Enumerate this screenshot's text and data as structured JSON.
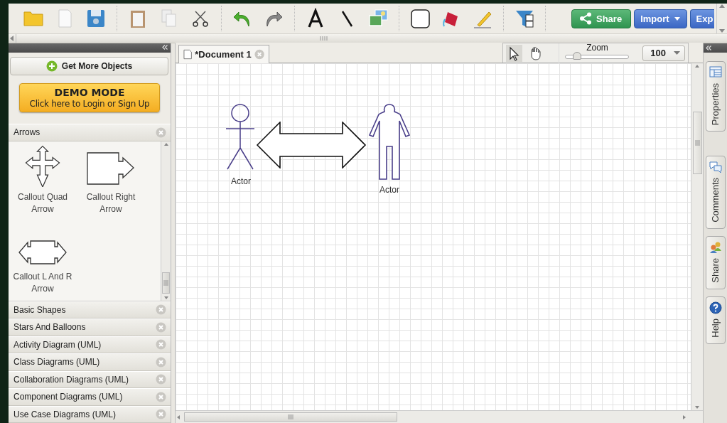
{
  "toolbar": {
    "actions": [
      {
        "label": "Share",
        "kind": "share"
      },
      {
        "label": "Import",
        "kind": "dropdown"
      },
      {
        "label": "Exp",
        "kind": "plain"
      }
    ]
  },
  "library": {
    "get_more": "Get More Objects",
    "demo": {
      "title": "DEMO MODE",
      "subtitle": "Click here to Login or Sign Up"
    },
    "open_category": {
      "title": "Arrows",
      "shapes": [
        {
          "label": "Callout Quad Arrow",
          "kind": "quad"
        },
        {
          "label": "Callout Right Arrow",
          "kind": "right"
        },
        {
          "label": "Callout L And R Arrow",
          "kind": "leftright"
        }
      ]
    },
    "categories": [
      "Basic Shapes",
      "Stars And Balloons",
      "Activity Diagram (UML)",
      "Class Diagrams (UML)",
      "Collaboration Diagrams (UML)",
      "Component Diagrams (UML)",
      "Use Case Diagrams (UML)"
    ]
  },
  "document": {
    "tab": "*Document 1",
    "tools": [
      {
        "kind": "pointer",
        "selected": true
      },
      {
        "kind": "hand",
        "selected": false
      }
    ],
    "zoom": {
      "label": "Zoom",
      "level": 0.18,
      "value": "100"
    },
    "shapes": [
      {
        "kind": "stick-actor",
        "label": "Actor"
      },
      {
        "kind": "double-arrow"
      },
      {
        "kind": "body-actor",
        "label": "Actor"
      }
    ]
  },
  "side_tabs": [
    {
      "label": "Properties",
      "kind": "properties"
    },
    {
      "label": "Comments",
      "kind": "comments"
    },
    {
      "label": "Share",
      "kind": "share"
    },
    {
      "label": "Help",
      "kind": "help"
    }
  ]
}
